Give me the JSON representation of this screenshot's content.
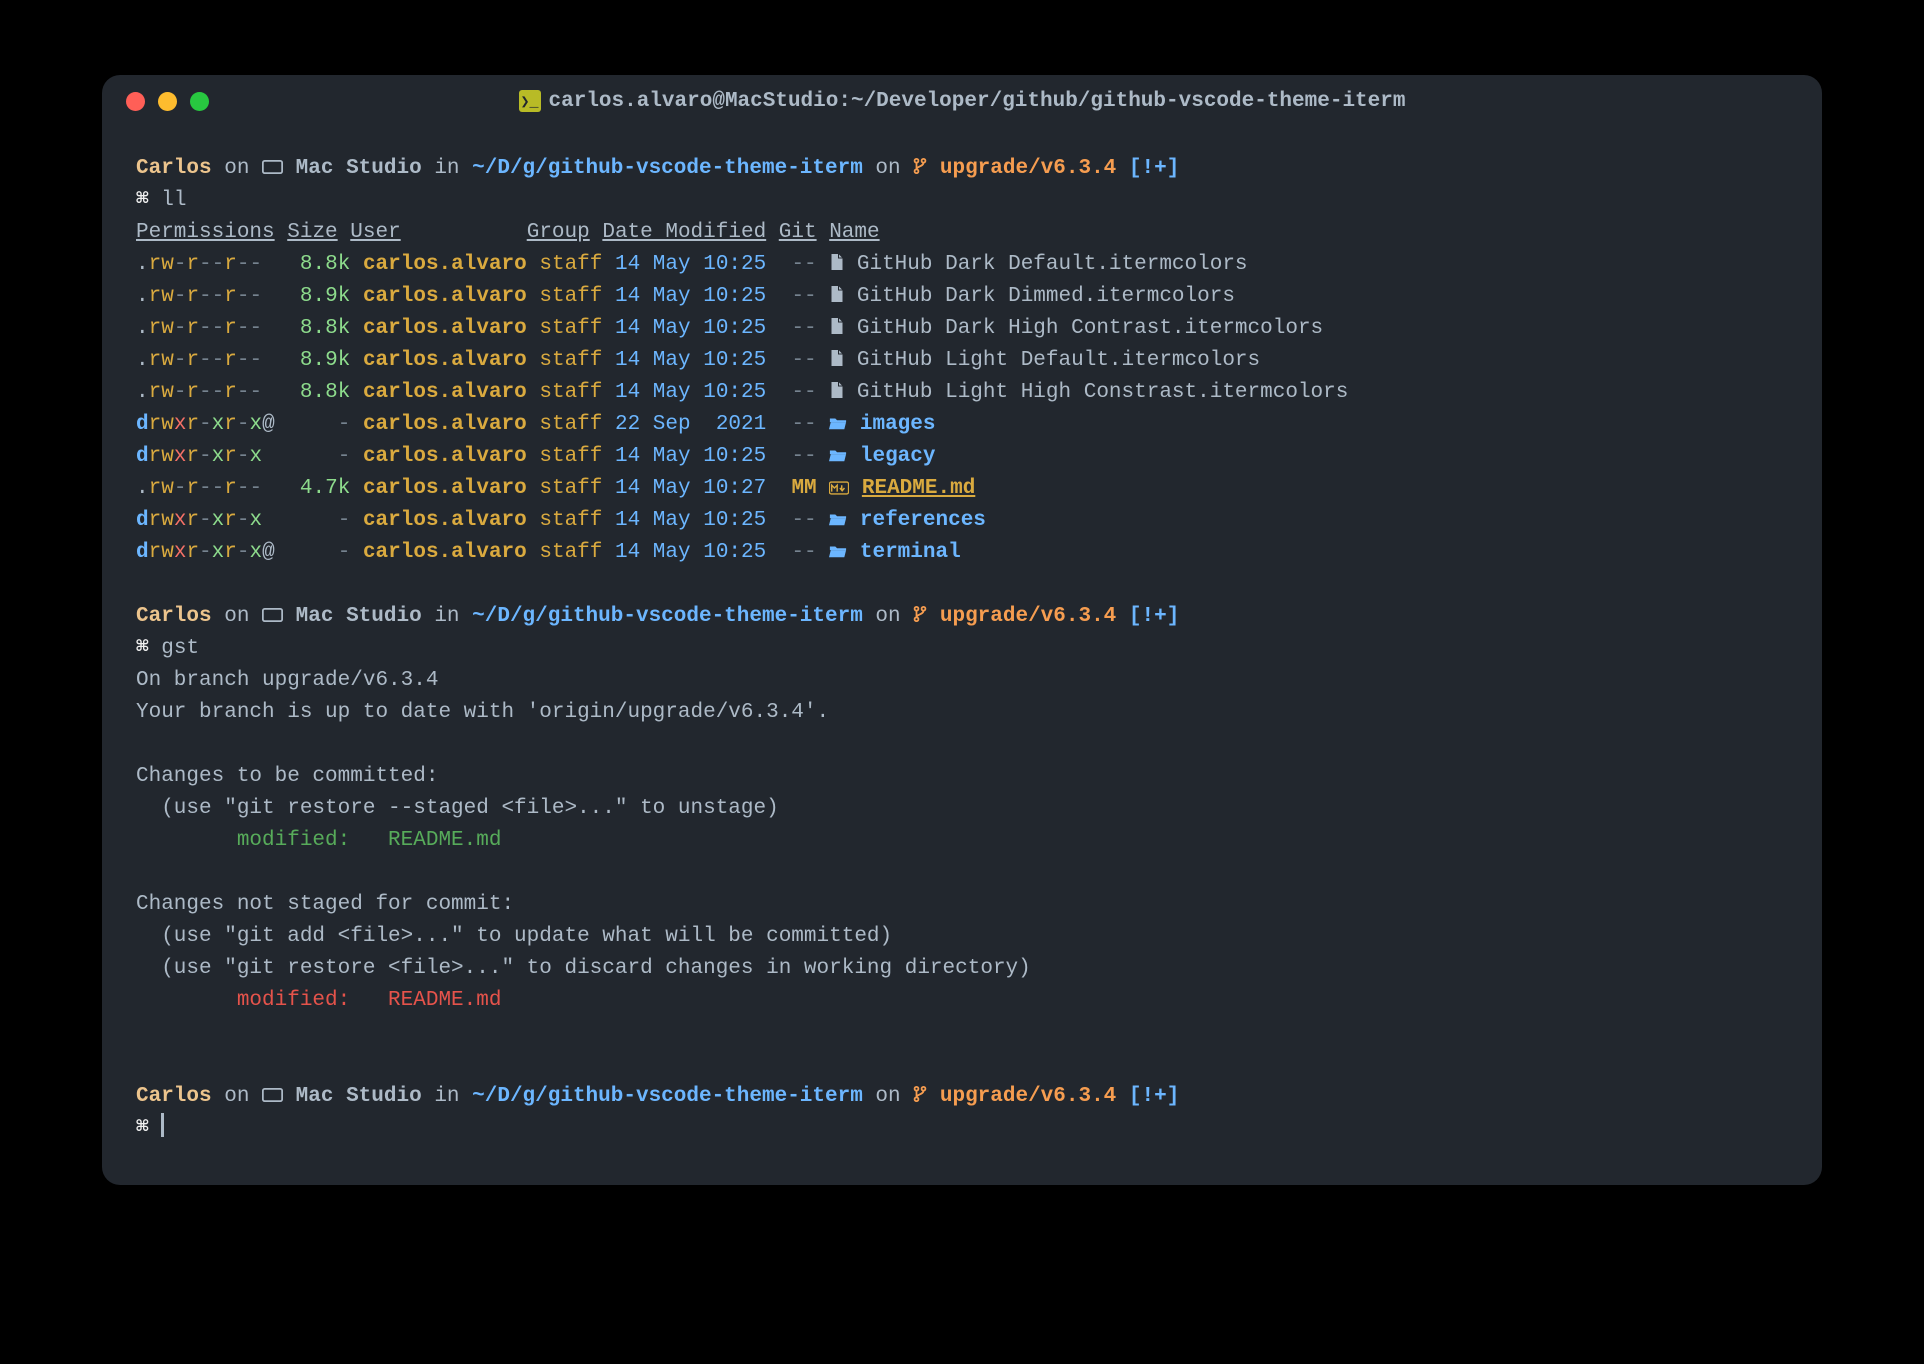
{
  "window": {
    "title": "carlos.alvaro@MacStudio:~/Developer/github/github-vscode-theme-iterm"
  },
  "prompt": {
    "user": "Carlos",
    "on": "on",
    "host": "Mac Studio",
    "in": "in",
    "path": "~/D/g/github-vscode-theme-iterm",
    "on2": "on",
    "branch": "upgrade/v6.3.4",
    "flags": "[!+]",
    "symbol": "⌘"
  },
  "cmd1": "ll",
  "cmd2": "gst",
  "headers": {
    "perm": "Permissions",
    "size": "Size",
    "user": "User",
    "group": "Group",
    "date": "Date Modified",
    "git": "Git",
    "name": "Name"
  },
  "files": [
    {
      "type": "file",
      "perm_pre": ".",
      "perm_rw": "rw",
      "dash1": "-",
      "perm_r2": "r",
      "dash2": "--",
      "perm_r3": "r",
      "dash3": "--",
      "size": "8.8k",
      "user": "carlos.alvaro",
      "group": "staff",
      "date": "14 May 10:25",
      "git": "--",
      "name": "GitHub Dark Default.itermcolors"
    },
    {
      "type": "file",
      "perm_pre": ".",
      "perm_rw": "rw",
      "dash1": "-",
      "perm_r2": "r",
      "dash2": "--",
      "perm_r3": "r",
      "dash3": "--",
      "size": "8.9k",
      "user": "carlos.alvaro",
      "group": "staff",
      "date": "14 May 10:25",
      "git": "--",
      "name": "GitHub Dark Dimmed.itermcolors"
    },
    {
      "type": "file",
      "perm_pre": ".",
      "perm_rw": "rw",
      "dash1": "-",
      "perm_r2": "r",
      "dash2": "--",
      "perm_r3": "r",
      "dash3": "--",
      "size": "8.8k",
      "user": "carlos.alvaro",
      "group": "staff",
      "date": "14 May 10:25",
      "git": "--",
      "name": "GitHub Dark High Contrast.itermcolors"
    },
    {
      "type": "file",
      "perm_pre": ".",
      "perm_rw": "rw",
      "dash1": "-",
      "perm_r2": "r",
      "dash2": "--",
      "perm_r3": "r",
      "dash3": "--",
      "size": "8.9k",
      "user": "carlos.alvaro",
      "group": "staff",
      "date": "14 May 10:25",
      "git": "--",
      "name": "GitHub Light Default.itermcolors"
    },
    {
      "type": "file",
      "perm_pre": ".",
      "perm_rw": "rw",
      "dash1": "-",
      "perm_r2": "r",
      "dash2": "--",
      "perm_r3": "r",
      "dash3": "--",
      "size": "8.8k",
      "user": "carlos.alvaro",
      "group": "staff",
      "date": "14 May 10:25",
      "git": "--",
      "name": "GitHub Light High Constrast.itermcolors"
    },
    {
      "type": "dir",
      "perm_pre": "d",
      "perm_rw": "rw",
      "perm_x": "x",
      "perm_r2": "r",
      "dash2": "-",
      "perm_x2": "x",
      "perm_r3": "r",
      "dash3": "-",
      "perm_x3": "x",
      "at": "@",
      "size": "-",
      "user": "carlos.alvaro",
      "group": "staff",
      "date": "22 Sep  2021",
      "git": "--",
      "name": "images"
    },
    {
      "type": "dir",
      "perm_pre": "d",
      "perm_rw": "rw",
      "perm_x": "x",
      "perm_r2": "r",
      "dash2": "-",
      "perm_x2": "x",
      "perm_r3": "r",
      "dash3": "-",
      "perm_x3": "x",
      "at": "",
      "size": "-",
      "user": "carlos.alvaro",
      "group": "staff",
      "date": "14 May 10:25",
      "git": "--",
      "name": "legacy"
    },
    {
      "type": "md",
      "perm_pre": ".",
      "perm_rw": "rw",
      "dash1": "-",
      "perm_r2": "r",
      "dash2": "--",
      "perm_r3": "r",
      "dash3": "--",
      "size": "4.7k",
      "user": "carlos.alvaro",
      "group": "staff",
      "date": "14 May 10:27",
      "git": "MM",
      "name": "README.md"
    },
    {
      "type": "dir",
      "perm_pre": "d",
      "perm_rw": "rw",
      "perm_x": "x",
      "perm_r2": "r",
      "dash2": "-",
      "perm_x2": "x",
      "perm_r3": "r",
      "dash3": "-",
      "perm_x3": "x",
      "at": "",
      "size": "-",
      "user": "carlos.alvaro",
      "group": "staff",
      "date": "14 May 10:25",
      "git": "--",
      "name": "references"
    },
    {
      "type": "dir",
      "perm_pre": "d",
      "perm_rw": "rw",
      "perm_x": "x",
      "perm_r2": "r",
      "dash2": "-",
      "perm_x2": "x",
      "perm_r3": "r",
      "dash3": "-",
      "perm_x3": "x",
      "at": "@",
      "size": "-",
      "user": "carlos.alvaro",
      "group": "staff",
      "date": "14 May 10:25",
      "git": "--",
      "name": "terminal"
    }
  ],
  "gst": {
    "l1": "On branch upgrade/v6.3.4",
    "l2": "Your branch is up to date with 'origin/upgrade/v6.3.4'.",
    "l3": "Changes to be committed:",
    "l4": "  (use \"git restore --staged <file>...\" to unstage)",
    "l5a": "        modified:   README.md",
    "l6": "Changes not staged for commit:",
    "l7": "  (use \"git add <file>...\" to update what will be committed)",
    "l8": "  (use \"git restore <file>...\" to discard changes in working directory)",
    "l9a": "        modified:   README.md"
  }
}
